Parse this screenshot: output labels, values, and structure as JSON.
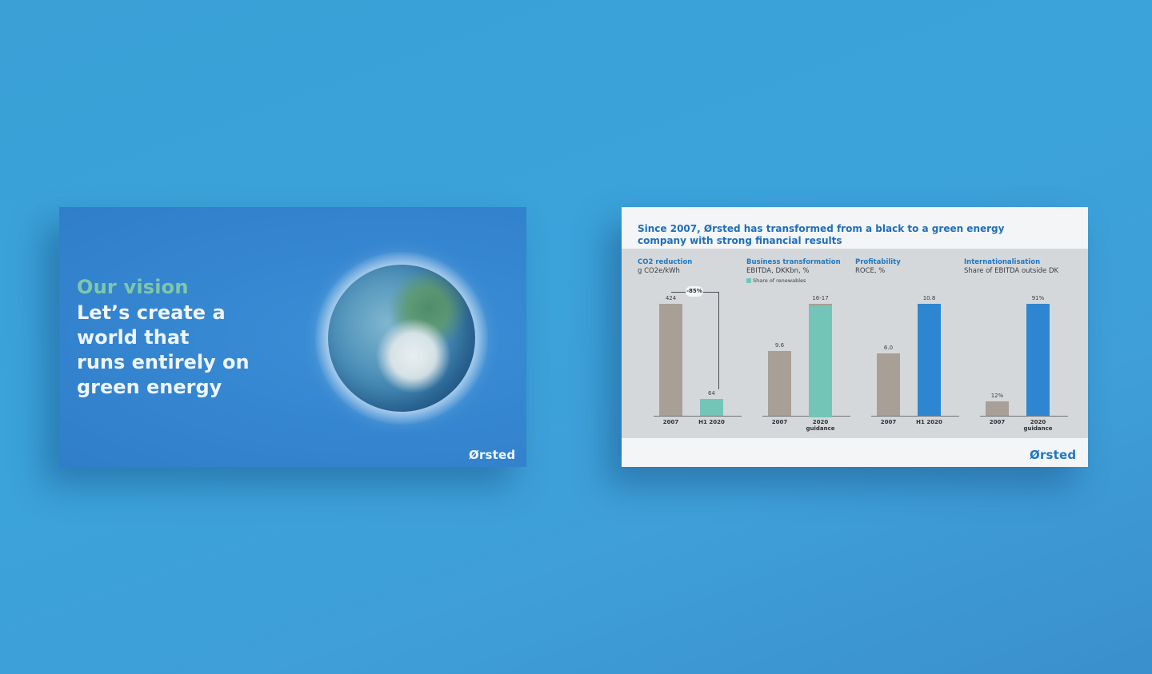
{
  "left_slide": {
    "vision_title": "Our vision",
    "vision_lines": [
      "Let’s create a",
      "world that",
      "runs entirely on",
      "green energy"
    ],
    "brand": "Ørsted",
    "globe_icon": "earth-globe"
  },
  "right_slide": {
    "brand": "Ørsted",
    "title": "Since 2007, Ørsted has transformed from a black to a green energy company with strong financial results"
  },
  "colors": {
    "background": "#3aa0d6",
    "accent_blue": "#1f78c1",
    "grey_bar": "#a89f97",
    "renewables_green": "#73c5b8",
    "bar_blue": "#2f86d0",
    "vision_green": "#7ec8a8"
  },
  "chart_data": [
    {
      "type": "bar",
      "title": "CO2 reduction",
      "subtitle": "g CO2e/kWh",
      "categories": [
        "2007",
        "H1 2020"
      ],
      "values": [
        424,
        64
      ],
      "value_labels": [
        "424",
        "64"
      ],
      "annotation": "-85%",
      "ylim": [
        0,
        424
      ]
    },
    {
      "type": "bar",
      "title": "Business transformation",
      "subtitle": "EBITDA, DKKbn, %",
      "legend": [
        "Share of renewables"
      ],
      "categories": [
        "2007",
        "2020 guidance"
      ],
      "values": [
        9.6,
        16.5
      ],
      "value_labels": [
        "9.6",
        "16-17"
      ],
      "ylim": [
        0,
        16.5
      ]
    },
    {
      "type": "bar",
      "title": "Profitability",
      "subtitle": "ROCE, %",
      "categories": [
        "2007",
        "H1 2020"
      ],
      "values": [
        6.0,
        10.8
      ],
      "value_labels": [
        "6.0",
        "10.8"
      ],
      "ylim": [
        0,
        10.8
      ]
    },
    {
      "type": "bar",
      "title": "Internationalisation",
      "subtitle": "Share of EBITDA outside DK",
      "categories": [
        "2007",
        "2020 guidance"
      ],
      "values": [
        12,
        91
      ],
      "value_labels": [
        "12%",
        "91%"
      ],
      "ylim": [
        0,
        91
      ]
    }
  ]
}
